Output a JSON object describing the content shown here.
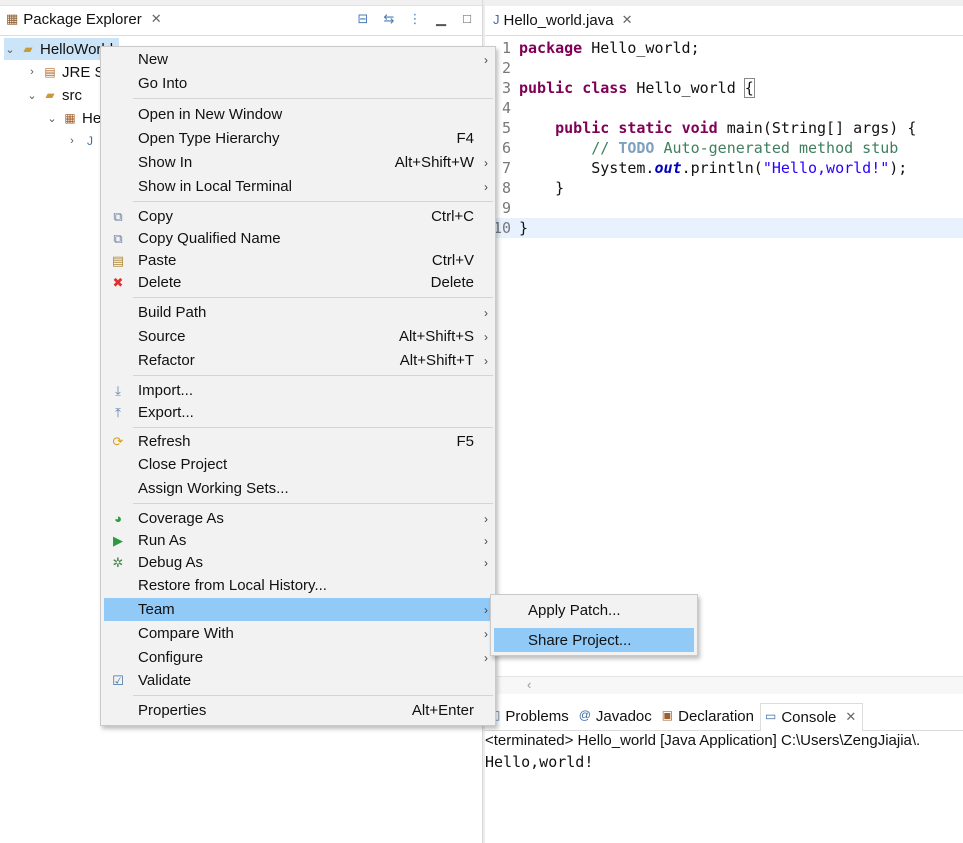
{
  "package_explorer": {
    "tab_title": "Package Explorer",
    "tree": [
      {
        "label": "HelloWorld",
        "icon": "project-folder-icon",
        "twisty": "expanded"
      },
      {
        "label": "JRE S",
        "icon": "library-icon",
        "twisty": "collapsed"
      },
      {
        "label": "src",
        "icon": "source-folder-icon",
        "twisty": "expanded"
      },
      {
        "label": "He",
        "icon": "package-icon",
        "twisty": "expanded"
      },
      {
        "label": "",
        "icon": "java-file-icon",
        "twisty": "collapsed"
      }
    ]
  },
  "editor": {
    "tab_title": "Hello_world.java",
    "line_numbers": [
      "1",
      "2",
      "3",
      "4",
      "5",
      "6",
      "7",
      "8",
      "9",
      "10"
    ]
  },
  "context_menu": {
    "items": [
      {
        "label": "New",
        "shortcut": "",
        "submenu": true
      },
      {
        "label": "Go Into",
        "shortcut": "",
        "submenu": false
      },
      {
        "label": "Open in New Window",
        "shortcut": "",
        "submenu": false
      },
      {
        "label": "Open Type Hierarchy",
        "shortcut": "F4",
        "submenu": false
      },
      {
        "label": "Show In",
        "shortcut": "Alt+Shift+W",
        "submenu": true
      },
      {
        "label": "Show in Local Terminal",
        "shortcut": "",
        "submenu": true
      },
      {
        "label": "Copy",
        "shortcut": "Ctrl+C",
        "submenu": false
      },
      {
        "label": "Copy Qualified Name",
        "shortcut": "",
        "submenu": false
      },
      {
        "label": "Paste",
        "shortcut": "Ctrl+V",
        "submenu": false
      },
      {
        "label": "Delete",
        "shortcut": "Delete",
        "submenu": false
      },
      {
        "label": "Build Path",
        "shortcut": "",
        "submenu": true
      },
      {
        "label": "Source",
        "shortcut": "Alt+Shift+S",
        "submenu": true
      },
      {
        "label": "Refactor",
        "shortcut": "Alt+Shift+T",
        "submenu": true
      },
      {
        "label": "Import...",
        "shortcut": "",
        "submenu": false
      },
      {
        "label": "Export...",
        "shortcut": "",
        "submenu": false
      },
      {
        "label": "Refresh",
        "shortcut": "F5",
        "submenu": false
      },
      {
        "label": "Close Project",
        "shortcut": "",
        "submenu": false
      },
      {
        "label": "Assign Working Sets...",
        "shortcut": "",
        "submenu": false
      },
      {
        "label": "Coverage As",
        "shortcut": "",
        "submenu": true
      },
      {
        "label": "Run As",
        "shortcut": "",
        "submenu": true
      },
      {
        "label": "Debug As",
        "shortcut": "",
        "submenu": true
      },
      {
        "label": "Restore from Local History...",
        "shortcut": "",
        "submenu": false
      },
      {
        "label": "Team",
        "shortcut": "",
        "submenu": true,
        "highlighted": true
      },
      {
        "label": "Compare With",
        "shortcut": "",
        "submenu": true
      },
      {
        "label": "Configure",
        "shortcut": "",
        "submenu": true
      },
      {
        "label": "Validate",
        "shortcut": "",
        "submenu": false
      },
      {
        "label": "Properties",
        "shortcut": "Alt+Enter",
        "submenu": false
      }
    ],
    "icons": {
      "copy": "copy-icon",
      "copy_qualified": "copy-qualified-name-icon",
      "paste": "paste-icon",
      "delete": "red-x-delete-icon",
      "import": "import-icon",
      "export": "export-icon",
      "refresh": "refresh-icon",
      "coverage": "coverage-icon",
      "run": "run-icon",
      "debug": "debug-bug-icon",
      "validate": "checkbox-checked-icon"
    }
  },
  "team_submenu": {
    "items": [
      {
        "label": "Apply Patch..."
      },
      {
        "label": "Share Project...",
        "highlighted": true
      }
    ]
  },
  "bottom_panel": {
    "tabs": [
      {
        "label": "Problems",
        "icon": "problems-icon"
      },
      {
        "label": "Javadoc",
        "icon": "javadoc-at-icon"
      },
      {
        "label": "Declaration",
        "icon": "declaration-icon"
      },
      {
        "label": "Console",
        "icon": "console-icon",
        "active": true
      }
    ],
    "console_status": "<terminated> Hello_world [Java Application] C:\\Users\\ZengJiajia\\.",
    "console_output": "Hello,world!"
  },
  "colors": {
    "menu_highlight": "#91c9f7",
    "keyword": "#7f0055",
    "comment": "#3f7f5f",
    "string": "#2a00ff",
    "current_line": "#e8f2fe"
  }
}
